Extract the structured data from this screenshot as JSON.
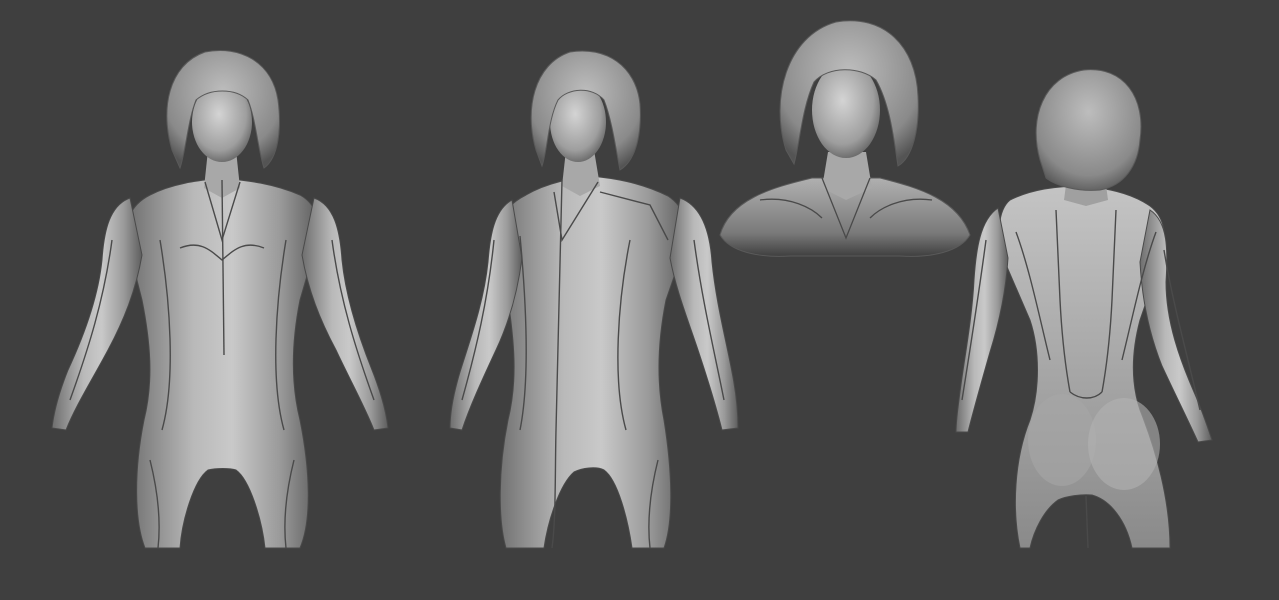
{
  "scene": {
    "background": "#3f3f3f",
    "clay_light": "#cfcfcf",
    "clay_mid": "#9a9a9a",
    "clay_dark": "#5a5a5a",
    "seam": "#4a4a4a"
  },
  "views": [
    {
      "id": "front",
      "kind": "full-body"
    },
    {
      "id": "three-quarter",
      "kind": "full-body"
    },
    {
      "id": "bust",
      "kind": "head-closeup"
    },
    {
      "id": "back",
      "kind": "full-body"
    }
  ]
}
